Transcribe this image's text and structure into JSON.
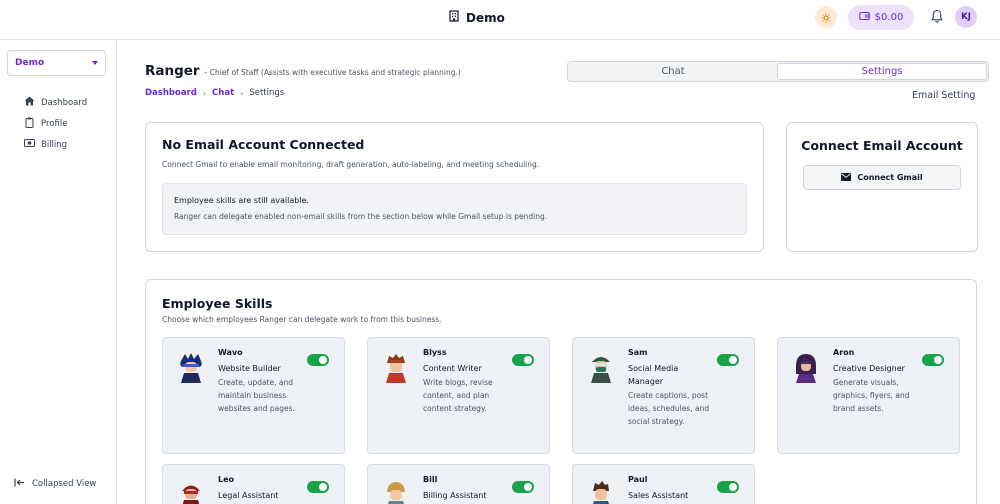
{
  "topbar": {
    "title": "Demo",
    "balance": "$0.00",
    "avatar_initials": "KJ"
  },
  "sidebar": {
    "workspace": "Demo",
    "items": [
      {
        "label": "Dashboard",
        "icon": "home-icon"
      },
      {
        "label": "Profile",
        "icon": "clipboard-icon"
      },
      {
        "label": "Billing",
        "icon": "money-icon"
      }
    ],
    "collapse_label": "Collapsed View"
  },
  "agent": {
    "name": "Ranger",
    "role": "– Chief of Staff (Assists with executive tasks and strategic planning.)"
  },
  "breadcrumb": [
    "Dashboard",
    "Chat",
    "Settings"
  ],
  "tabs": [
    {
      "label": "Chat",
      "active": false
    },
    {
      "label": "Settings",
      "active": true
    }
  ],
  "section_label": "Email Setting",
  "email_card": {
    "title": "No Email Account Connected",
    "description": "Connect Gmail to enable email monitoring, draft generation, auto-labeling, and meeting scheduling.",
    "notice_title": "Employee skills are still available.",
    "notice_body": "Ranger can delegate enabled non-email skills from the section below while Gmail setup is pending."
  },
  "connect_card": {
    "title": "Connect Email Account",
    "button": "Connect Gmail"
  },
  "skills": {
    "title": "Employee Skills",
    "subtitle": "Choose which employees Ranger can delegate work to from this business.",
    "employees": [
      {
        "name": "Wavo",
        "title": "Website Builder",
        "description": "Create, update, and maintain business websites and pages.",
        "enabled": true
      },
      {
        "name": "Blyss",
        "title": "Content Writer",
        "description": "Write blogs, revise content, and plan content strategy.",
        "enabled": true
      },
      {
        "name": "Sam",
        "title": "Social Media Manager",
        "description": "Create captions, post ideas, schedules, and social strategy.",
        "enabled": true
      },
      {
        "name": "Aron",
        "title": "Creative Designer",
        "description": "Generate visuals, graphics, flyers, and brand assets.",
        "enabled": true
      },
      {
        "name": "Leo",
        "title": "Legal Assistant",
        "description": "",
        "enabled": true
      },
      {
        "name": "Bill",
        "title": "Billing Assistant",
        "description": "",
        "enabled": true
      },
      {
        "name": "Paul",
        "title": "Sales Assistant",
        "description": "",
        "enabled": true
      }
    ]
  },
  "colors": {
    "accent": "#6d28d9",
    "toggle_on": "#16a34a",
    "card_bg": "#eef1f6"
  }
}
